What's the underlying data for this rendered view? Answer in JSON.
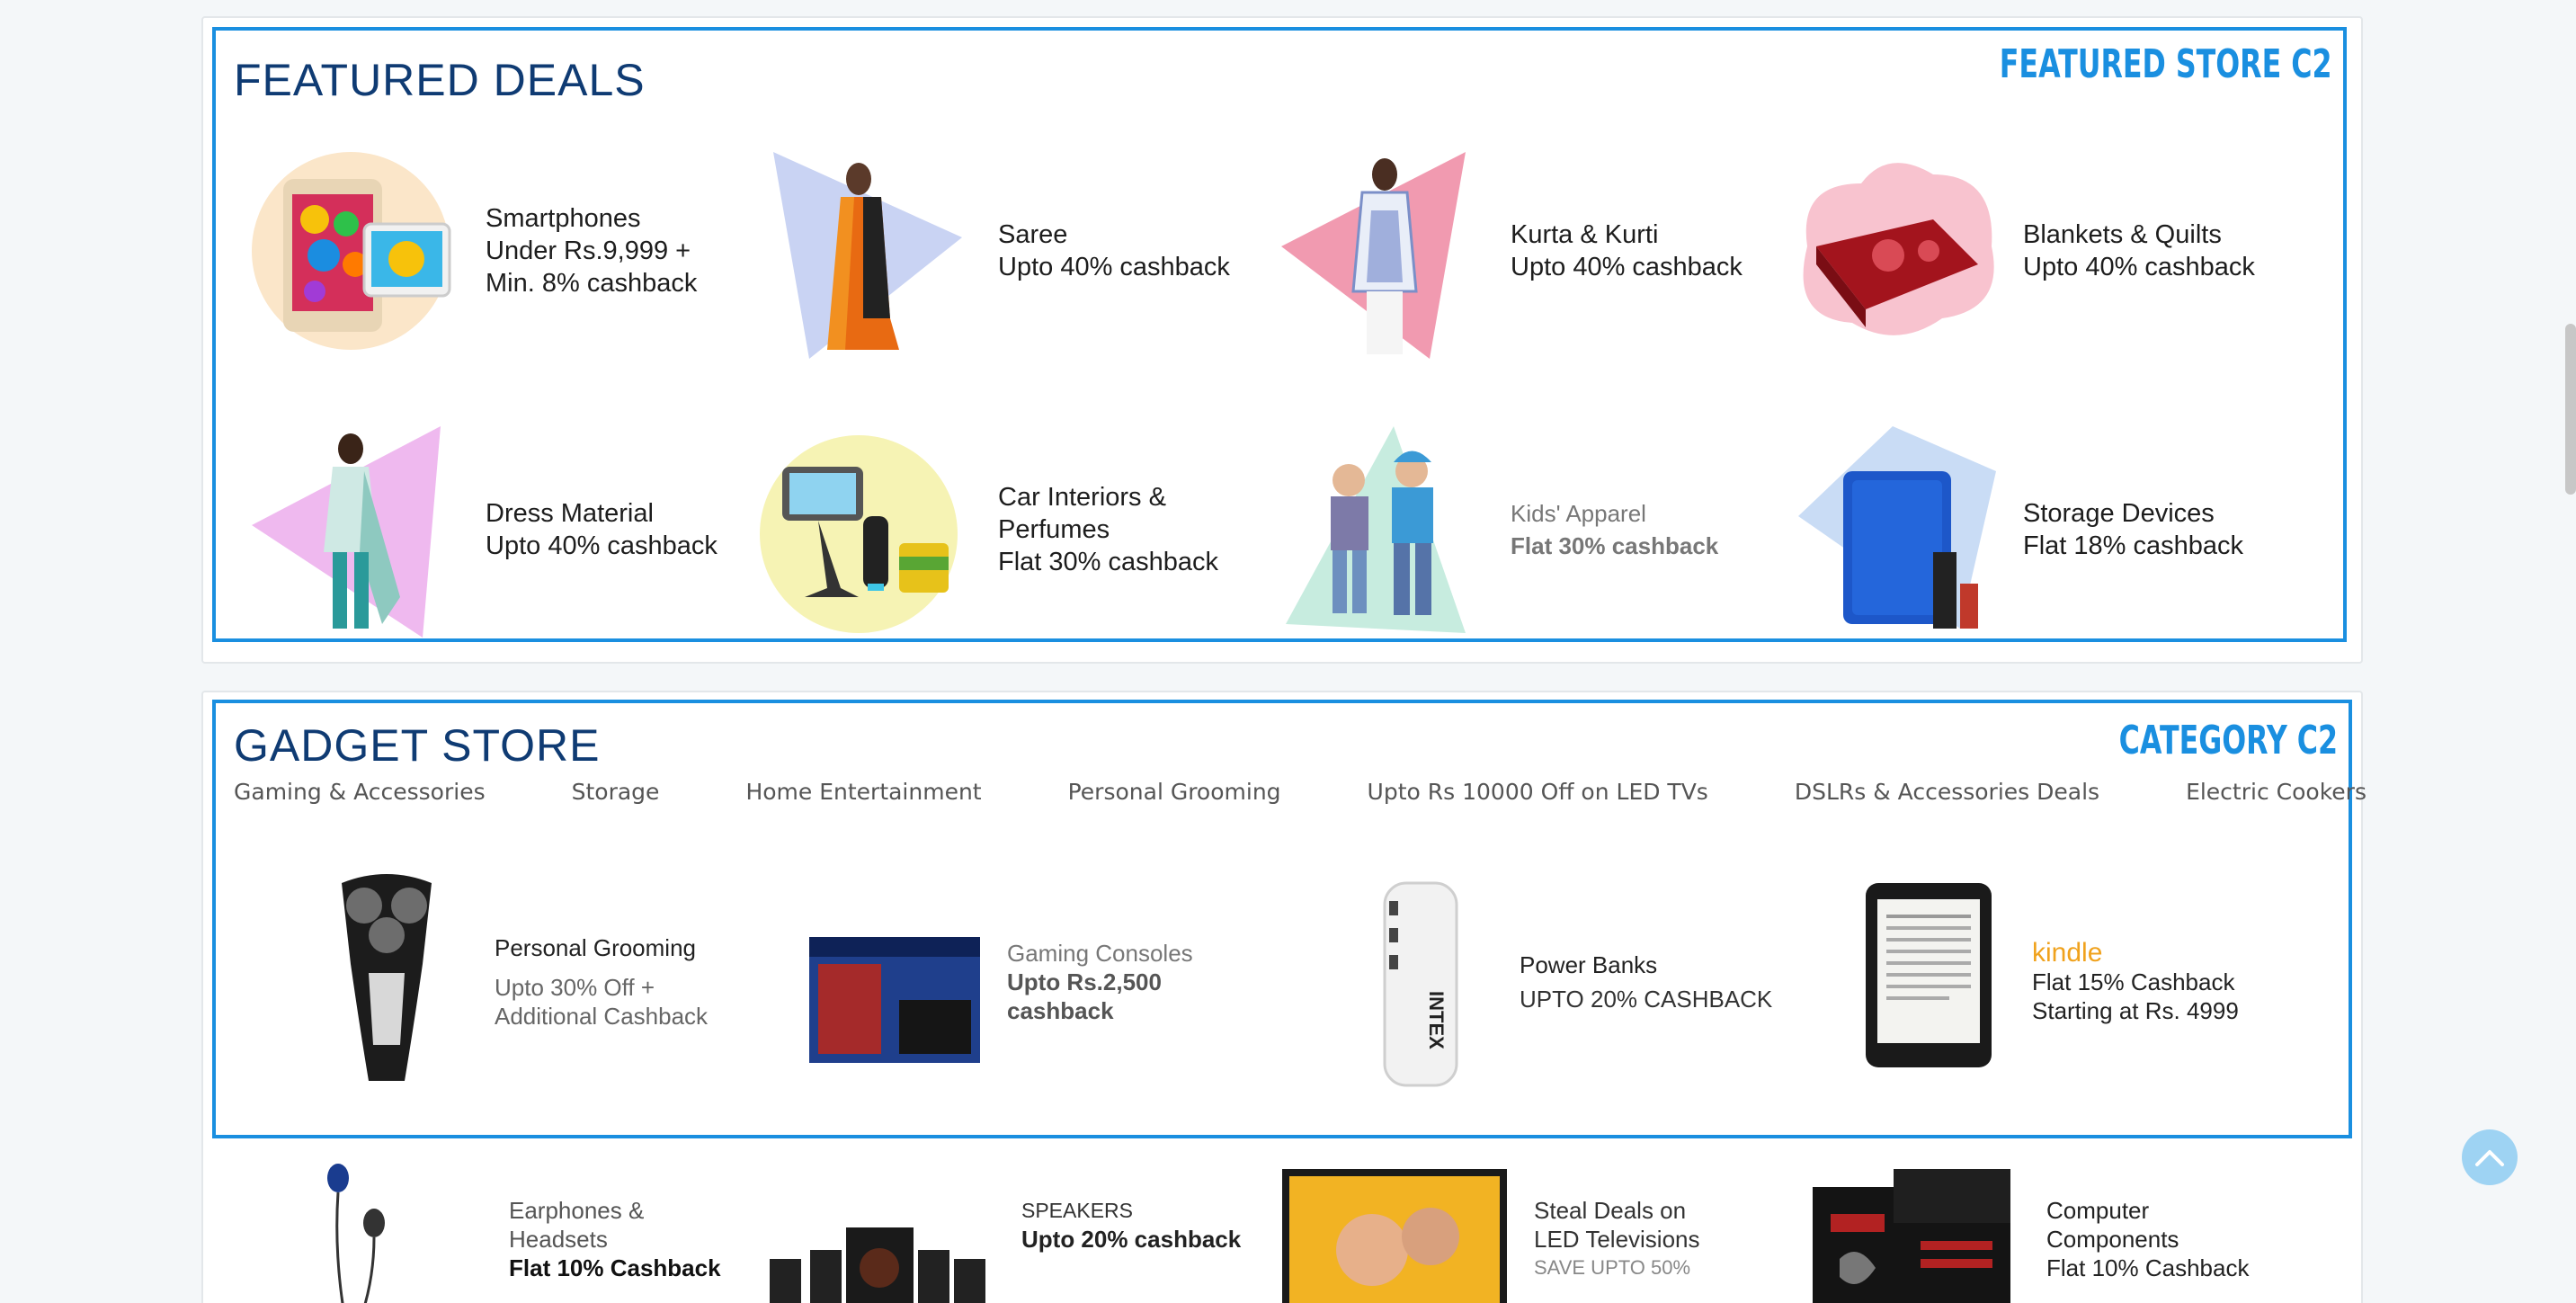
{
  "featured": {
    "title": "FEATURED DEALS",
    "tag": "FEATURED STORE C2",
    "deals": [
      {
        "icon": "smartphone-image",
        "lines": [
          "Smartphones",
          "Under Rs.9,999 +",
          "Min. 8% cashback"
        ]
      },
      {
        "icon": "saree-image",
        "lines": [
          "Saree",
          "Upto 40% cashback"
        ]
      },
      {
        "icon": "kurta-image",
        "lines": [
          "Kurta & Kurti",
          "Upto 40% cashback"
        ]
      },
      {
        "icon": "blanket-image",
        "lines": [
          "Blankets & Quilts",
          "Upto 40% cashback"
        ]
      },
      {
        "icon": "dress-material-image",
        "lines": [
          "Dress Material",
          "Upto 40% cashback"
        ]
      },
      {
        "icon": "car-accessories-image",
        "lines": [
          "Car Interiors &",
          "Perfumes",
          "Flat 30% cashback"
        ]
      },
      {
        "icon": "kids-apparel-image",
        "lines": [
          "Kids' Apparel",
          "Flat  30% cashback"
        ]
      },
      {
        "icon": "storage-device-image",
        "lines": [
          "Storage Devices",
          "Flat 18% cashback"
        ]
      }
    ]
  },
  "gadget": {
    "title": "GADGET STORE",
    "tag": "CATEGORY C2",
    "categories": [
      "Gaming & Accessories",
      "Storage",
      "Home Entertainment",
      "Personal Grooming",
      "Upto Rs 10000 Off on LED TVs",
      "DSLRs & Accessories Deals",
      "Electric Cookers"
    ],
    "cards": [
      {
        "icon": "shaver-image",
        "lines": [
          "Personal Grooming",
          "Upto 30% Off +",
          "Additional Cashback"
        ]
      },
      {
        "icon": "ps4-image",
        "lines": [
          "Gaming Consoles",
          "Upto Rs.2,500",
          "cashback"
        ]
      },
      {
        "icon": "power-bank-image",
        "lines": [
          "Power Banks",
          "UPTO 20% CASHBACK"
        ]
      },
      {
        "icon": "kindle-image",
        "lines": [
          "kindle",
          "Flat 15% Cashback",
          "Starting at Rs. 4999"
        ]
      }
    ],
    "more": [
      {
        "icon": "earphones-image",
        "lines": [
          "Earphones &",
          "Headsets",
          "Flat 10% Cashback"
        ]
      },
      {
        "icon": "speakers-image",
        "lines": [
          "SPEAKERS",
          "Upto 20% cashback"
        ]
      },
      {
        "icon": "led-tv-image",
        "lines": [
          "Steal Deals on",
          "LED Televisions",
          "SAVE UPTO 50%"
        ]
      },
      {
        "icon": "motherboard-image",
        "lines": [
          "Computer",
          "Components",
          "Flat 10% Cashback"
        ]
      }
    ]
  },
  "scroll_top": {
    "icon": "chevron-up-icon"
  },
  "colors": {
    "accent": "#1a8fe0",
    "title": "#0f3b73"
  }
}
